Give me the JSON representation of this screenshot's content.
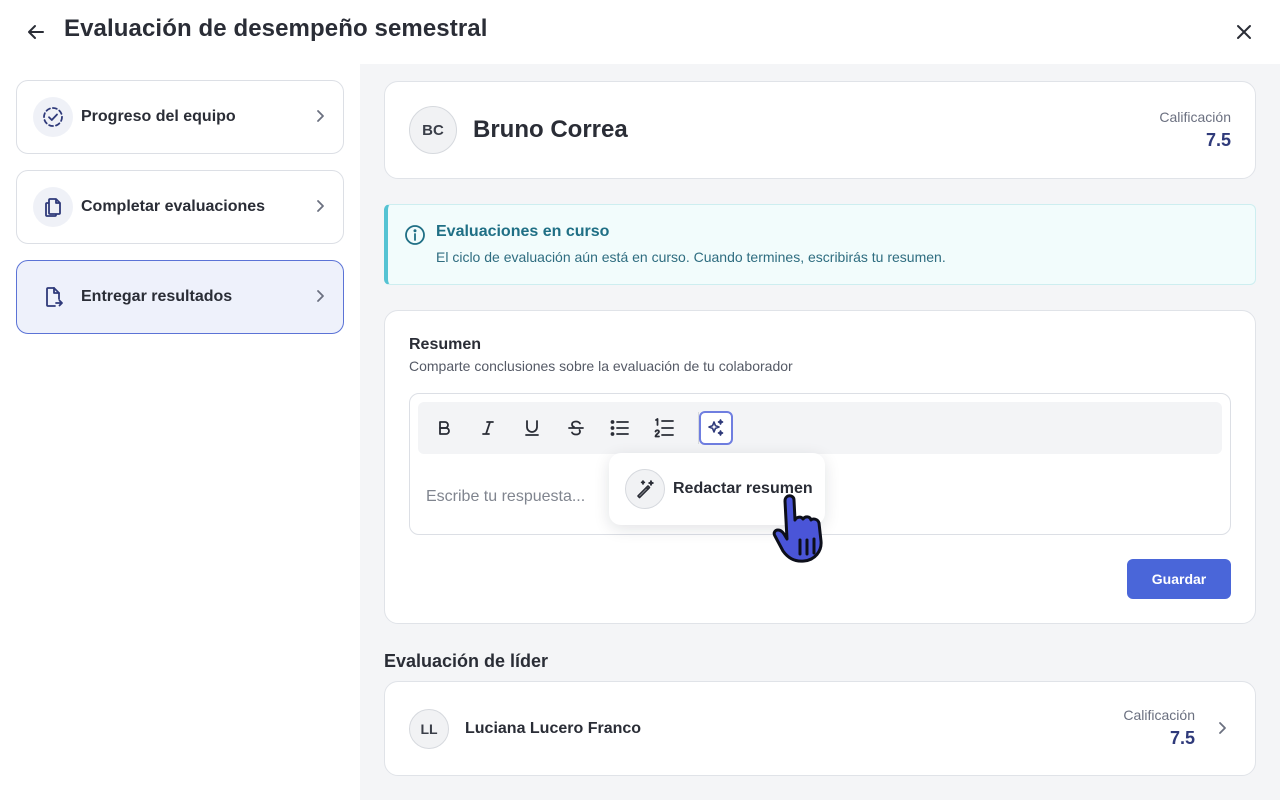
{
  "header": {
    "title": "Evaluación de desempeño semestral",
    "back_icon": "arrow-left-icon",
    "close_icon": "close-icon"
  },
  "sidebar": {
    "items": [
      {
        "label": "Progreso del equipo",
        "icon": "dashed-circle-check-icon",
        "active": false
      },
      {
        "label": "Completar evaluaciones",
        "icon": "copy-documents-icon",
        "active": false
      },
      {
        "label": "Entregar resultados",
        "icon": "document-arrow-icon",
        "active": true
      }
    ]
  },
  "profile": {
    "initials": "BC",
    "name": "Bruno Correa",
    "grade_label": "Calificación",
    "grade_value": "7.5"
  },
  "info_banner": {
    "title": "Evaluaciones en curso",
    "text": "El ciclo de evaluación aún está en curso. Cuando termines, escribirás tu resumen.",
    "icon": "info-icon"
  },
  "summary": {
    "title": "Resumen",
    "subtitle": "Comparte conclusiones sobre la evaluación de tu colaborador",
    "placeholder": "Escribe tu respuesta...",
    "toolbar": [
      "bold-icon",
      "italic-icon",
      "underline-icon",
      "strikethrough-icon",
      "bullet-list-icon",
      "numbered-list-icon",
      "sparkles-icon"
    ],
    "ai_popover_label": "Redactar resumen",
    "save_label": "Guardar"
  },
  "leader_section": {
    "title": "Evaluación de líder",
    "initials": "LL",
    "name": "Luciana Lucero Franco",
    "grade_label": "Calificación",
    "grade_value": "7.5"
  },
  "colors": {
    "accent": "#4a66d9",
    "info_border": "#55c3d3",
    "grade": "#2f3a7a"
  }
}
